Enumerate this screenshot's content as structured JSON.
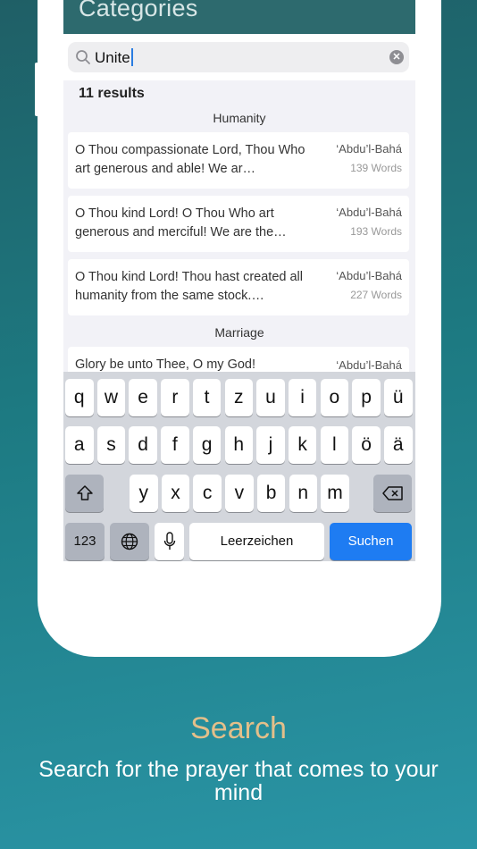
{
  "header": {
    "title": "Categories"
  },
  "search": {
    "value": "Unite"
  },
  "results": {
    "count_label": "11 results"
  },
  "sections": [
    {
      "title": "Humanity",
      "items": [
        {
          "text": "O Thou compassionate Lord, Thou Who art generous and able! We ar…",
          "author": "‘Abdu’l-Bahá",
          "words": "139 Words"
        },
        {
          "text": "O Thou kind Lord! O Thou Who art generous and merciful! We are the…",
          "author": "‘Abdu’l-Bahá",
          "words": "193 Words"
        },
        {
          "text": "O Thou kind Lord! Thou hast created all humanity from the same stock.…",
          "author": "‘Abdu’l-Bahá",
          "words": "227 Words"
        }
      ]
    },
    {
      "title": "Marriage",
      "items": [
        {
          "text": "Glory be unto Thee, O my God!",
          "author": "‘Abdu’l-Bahá"
        }
      ]
    }
  ],
  "keyboard": {
    "row1": [
      "q",
      "w",
      "e",
      "r",
      "t",
      "z",
      "u",
      "i",
      "o",
      "p",
      "ü"
    ],
    "row2": [
      "a",
      "s",
      "d",
      "f",
      "g",
      "h",
      "j",
      "k",
      "l",
      "ö",
      "ä"
    ],
    "row3": [
      "y",
      "x",
      "c",
      "v",
      "b",
      "n",
      "m"
    ],
    "numbers_key": "123",
    "space_key": "Leerzeichen",
    "search_key": "Suchen"
  },
  "caption": {
    "title": "Search",
    "subtitle": "Search for the prayer that comes to your mind"
  },
  "colors": {
    "accent": "#e3bf8a",
    "keyboard_action": "#1e7cf2",
    "header_bar": "#2d6a6e"
  }
}
